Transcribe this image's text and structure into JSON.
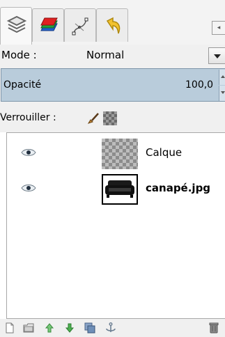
{
  "dock": {
    "tabs": [
      {
        "name": "layers-tab",
        "icon": "layers-icon",
        "active": true
      },
      {
        "name": "channels-tab",
        "icon": "channels-icon",
        "active": false
      },
      {
        "name": "paths-tab",
        "icon": "paths-icon",
        "active": false
      },
      {
        "name": "undo-history-tab",
        "icon": "undo-history-icon",
        "active": false
      }
    ],
    "tab_menu_icon": "tab-menu-icon"
  },
  "mode": {
    "label": "Mode :",
    "value": "Normal"
  },
  "opacity": {
    "label": "Opacité",
    "value": "100,0"
  },
  "lock": {
    "label": "Verrouiller :",
    "icons": [
      "lock-pixels-icon",
      "lock-alpha-icon"
    ]
  },
  "layers": [
    {
      "name": "Calque",
      "visible": true,
      "thumbnail": "transparent",
      "bold": false
    },
    {
      "name": "canapé.jpg",
      "visible": true,
      "thumbnail": "sofa-image",
      "bold": true
    }
  ],
  "toolbar": {
    "buttons": [
      "new-layer-icon",
      "new-layer-group-icon",
      "raise-layer-icon",
      "lower-layer-icon",
      "duplicate-layer-icon",
      "anchor-layer-icon",
      "delete-layer-icon"
    ]
  },
  "colors": {
    "opacity_bg": "#b9ccdb",
    "panel_bg": "#f0f0f0",
    "raise_green": "#4caf50"
  }
}
